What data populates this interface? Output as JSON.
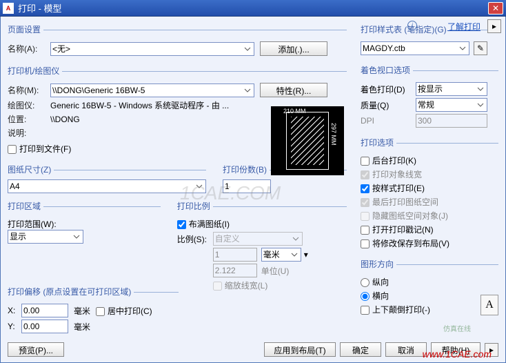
{
  "window": {
    "title": "打印 - 模型",
    "help": "了解打印",
    "expand": ">"
  },
  "pageSetup": {
    "legend": "页面设置",
    "nameLabel": "名称(A):",
    "nameValue": "<无>",
    "addBtn": "添加(.)..."
  },
  "printer": {
    "legend": "打印机/绘图仪",
    "nameLabel": "名称(M):",
    "nameValue": "\\\\DONG\\Generic 16BW-5",
    "propsBtn": "特性(R)...",
    "plotterLabel": "绘图仪:",
    "plotterValue": "Generic 16BW-5 - Windows 系统驱动程序 - 由 ...",
    "whereLabel": "位置:",
    "whereValue": "\\\\DONG",
    "descLabel": "说明:",
    "fileChk": "打印到文件(F)",
    "dimTop": "210 MM",
    "dimRight": "297 MM"
  },
  "paperSize": {
    "legend": "图纸尺寸(Z)",
    "value": "A4"
  },
  "copies": {
    "legend": "打印份数(B)",
    "value": "1"
  },
  "area": {
    "legend": "打印区域",
    "scopeLabel": "打印范围(W):",
    "value": "显示"
  },
  "scale": {
    "legend": "打印比例",
    "fitChk": "布满图纸(I)",
    "ratioLabel": "比例(S):",
    "ratioValue": "自定义",
    "num": "1",
    "numUnit": "毫米",
    "den": "2.122",
    "denUnit": "单位(U)",
    "scaleLwChk": "缩放线宽(L)"
  },
  "offset": {
    "legend": "打印偏移 (原点设置在可打印区域)",
    "xLabel": "X:",
    "x": "0.00",
    "yLabel": "Y:",
    "y": "0.00",
    "unit": "毫米",
    "centerChk": "居中打印(C)"
  },
  "styleTable": {
    "legend": "打印样式表 (笔指定)(G)",
    "value": "MAGDY.ctb"
  },
  "viewport": {
    "legend": "着色视口选项",
    "shadeLabel": "着色打印(D)",
    "shadeValue": "按显示",
    "qualityLabel": "质量(Q)",
    "qualityValue": "常规",
    "dpiLabel": "DPI",
    "dpiValue": "300"
  },
  "options": {
    "legend": "打印选项",
    "bg": "后台打印(K)",
    "lw": "打印对象线宽",
    "styles": "按样式打印(E)",
    "last": "最后打印图纸空间",
    "hide": "隐藏图纸空间对象(J)",
    "stamp": "打开打印戳记(N)",
    "save": "将修改保存到布局(V)"
  },
  "orient": {
    "legend": "图形方向",
    "portrait": "纵向",
    "landscape": "横向",
    "upside": "上下颠倒打印(-)"
  },
  "buttons": {
    "preview": "预览(P)...",
    "apply": "应用到布局(T)",
    "ok": "确定",
    "cancel": "取消",
    "help": "帮助(H)"
  },
  "watermark": {
    "center": "1CAE.COM",
    "url": "www.1CAE.com",
    "corner": "仿真在线"
  }
}
